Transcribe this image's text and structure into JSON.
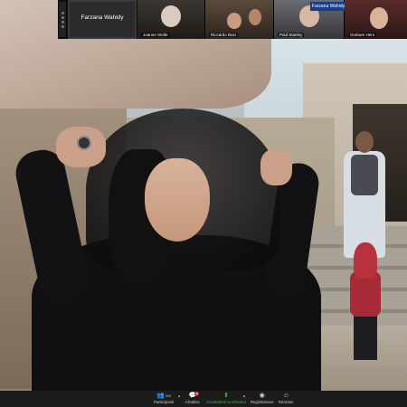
{
  "participants": {
    "tiles": [
      {
        "name": "Farzana Wahidy",
        "type": "active-speaker"
      },
      {
        "name": "Joanne Stolte"
      },
      {
        "name": "Riccardo Bosi"
      },
      {
        "name": "Paul Stanley"
      },
      {
        "name": "Graham Hero"
      }
    ],
    "banner_text": "Farzana Wahidy"
  },
  "toolbar": {
    "participants_label": "Partecipanti",
    "participants_count": "344",
    "chat_label": "Chatbox",
    "share_label": "Condividere lo schermo",
    "record_label": "Registrazione",
    "reactions_label": "Reazioni"
  },
  "icons": {
    "participants": "people-icon",
    "chat": "chat-icon",
    "share": "share-screen-icon",
    "record": "record-icon",
    "reactions": "smiley-icon"
  },
  "colors": {
    "share_accent": "#27c43a",
    "toolbar_bg": "#1c1c1c",
    "strip_bg": "#0d0d0d"
  }
}
